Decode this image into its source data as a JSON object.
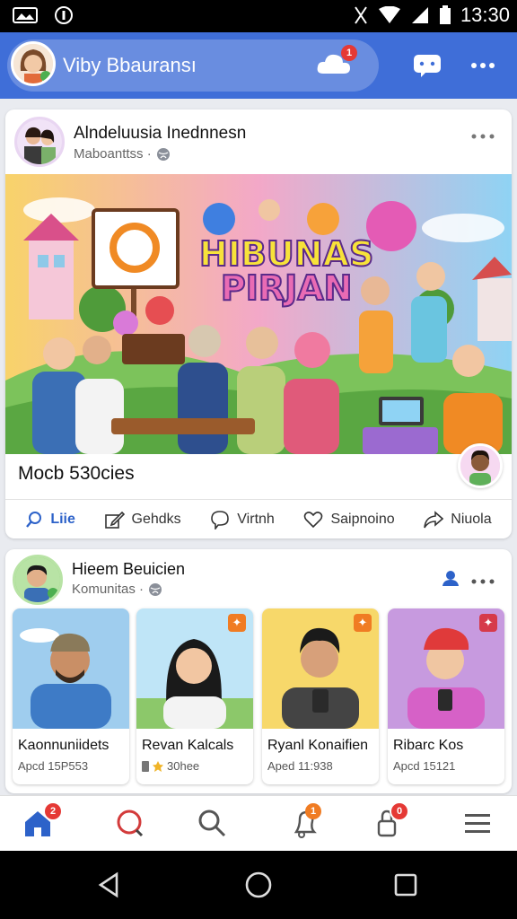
{
  "status_bar": {
    "time": "13:30"
  },
  "header": {
    "title": "Viby Bbauransı",
    "notification_count": "1"
  },
  "post1": {
    "author": "Alndeluusia Inednnesn",
    "subtitle": "Mabоanttss ·",
    "image_title_line1": "HIBUNAS",
    "image_title_line2": "PIRJAN",
    "caption": "Mocb 530cies",
    "actions": [
      {
        "label": "Liie",
        "icon": "search-icon"
      },
      {
        "label": "Gehdks",
        "icon": "edit-icon"
      },
      {
        "label": "Virtnh",
        "icon": "comment-icon"
      },
      {
        "label": "Saipnoino",
        "icon": "heart-icon"
      },
      {
        "label": "Niuola",
        "icon": "share-icon"
      }
    ]
  },
  "post2": {
    "author": "Hieem Beuicien",
    "subtitle": "Komunitas ·",
    "profiles": [
      {
        "name": "Kaonnuniidets",
        "sub": "Apcd 15P553"
      },
      {
        "name": "Revan Kalcals",
        "sub": "30hee"
      },
      {
        "name": "Ryanl Konaifien",
        "sub": "Aped 11:938"
      },
      {
        "name": "Ribarc Kos",
        "sub": "Apcd 15121"
      }
    ]
  },
  "bottom_nav": {
    "home_badge": "2",
    "notif_badge": "1",
    "profile_badge": "0"
  },
  "colors": {
    "brand": "#3f6ed8",
    "accent_blue": "#2d62c9",
    "badge_red": "#e53935",
    "badge_orange": "#f07c23"
  }
}
